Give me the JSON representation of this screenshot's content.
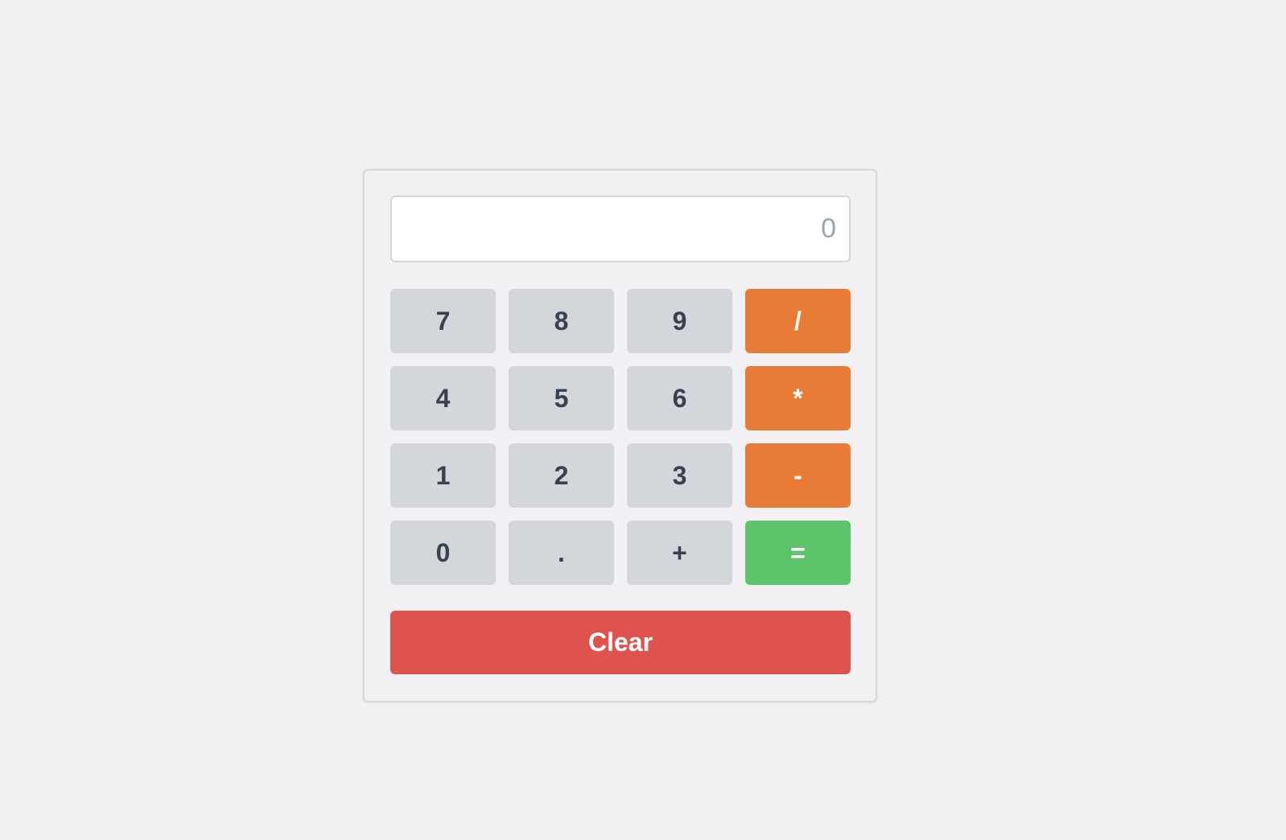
{
  "display": {
    "value": "0"
  },
  "keys": [
    {
      "label": "7",
      "type": "num"
    },
    {
      "label": "8",
      "type": "num"
    },
    {
      "label": "9",
      "type": "num"
    },
    {
      "label": "/",
      "type": "op"
    },
    {
      "label": "4",
      "type": "num"
    },
    {
      "label": "5",
      "type": "num"
    },
    {
      "label": "6",
      "type": "num"
    },
    {
      "label": "*",
      "type": "op"
    },
    {
      "label": "1",
      "type": "num"
    },
    {
      "label": "2",
      "type": "num"
    },
    {
      "label": "3",
      "type": "num"
    },
    {
      "label": "-",
      "type": "op"
    },
    {
      "label": "0",
      "type": "num"
    },
    {
      "label": ".",
      "type": "num"
    },
    {
      "label": "+",
      "type": "num"
    },
    {
      "label": "=",
      "type": "eq"
    }
  ],
  "clear_label": "Clear",
  "colors": {
    "operator": "#e87c37",
    "equals": "#5dc46a",
    "clear": "#df534e",
    "digit": "#d3d6db"
  }
}
